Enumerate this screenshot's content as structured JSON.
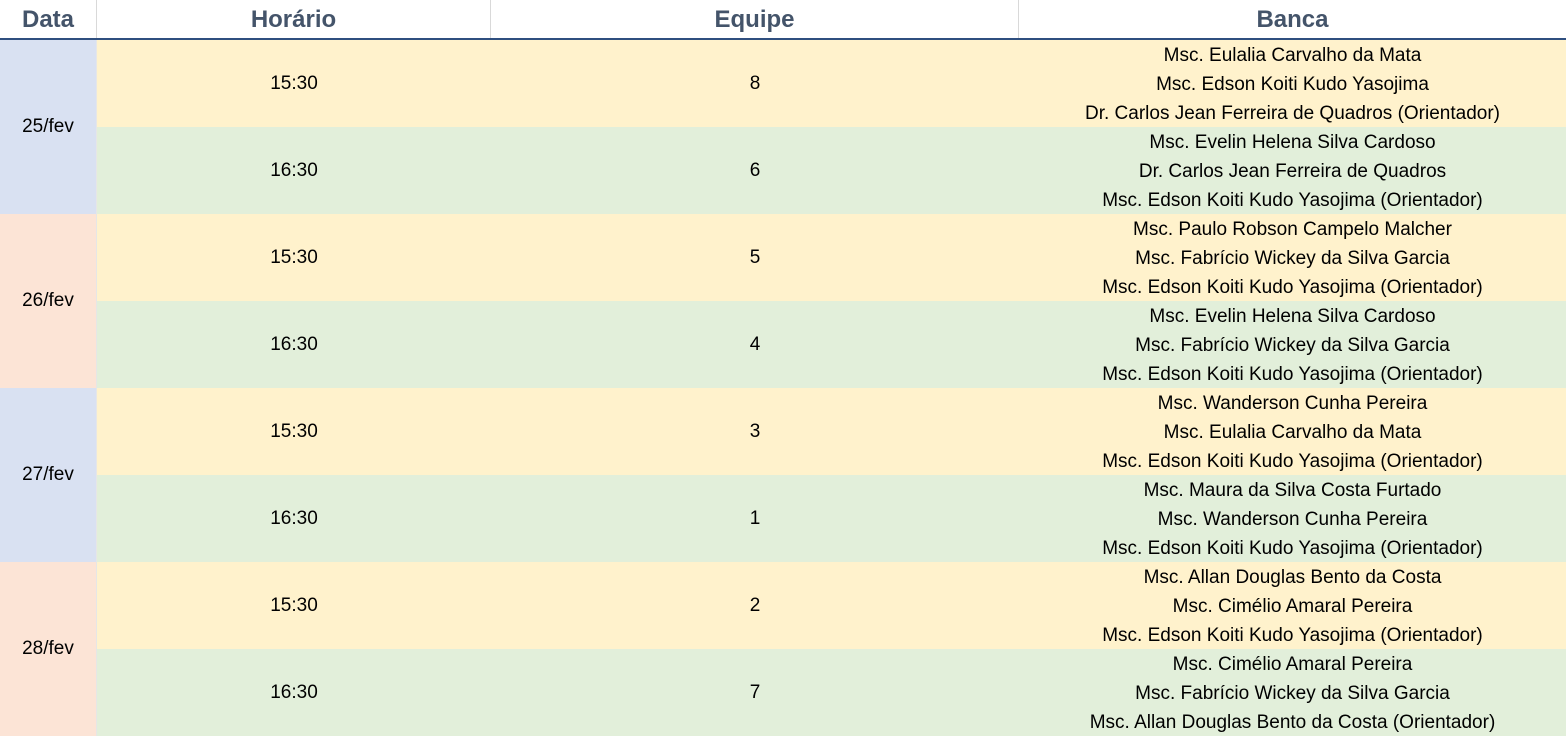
{
  "headers": {
    "data": "Data",
    "horario": "Horário",
    "equipe": "Equipe",
    "banca": "Banca"
  },
  "colors": {
    "header_text": "#44546a",
    "header_rule": "#2f4f7f",
    "date_blue": "#d9e1f2",
    "date_peach": "#fce4d6",
    "row_yellow": "#fff2cc",
    "row_green": "#e2efda"
  },
  "days": [
    {
      "date": "25/fev",
      "color": "#d9e1f2",
      "slots": [
        {
          "time": "15:30",
          "team": "8",
          "color": "#fff2cc",
          "banca": [
            "Msc. Eulalia Carvalho da Mata",
            "Msc. Edson Koiti Kudo Yasojima",
            "Dr. Carlos Jean Ferreira de Quadros (Orientador)"
          ]
        },
        {
          "time": "16:30",
          "team": "6",
          "color": "#e2efda",
          "banca": [
            "Msc. Evelin Helena Silva Cardoso",
            "Dr. Carlos Jean Ferreira de Quadros",
            "Msc. Edson Koiti Kudo Yasojima (Orientador)"
          ]
        }
      ]
    },
    {
      "date": "26/fev",
      "color": "#fce4d6",
      "slots": [
        {
          "time": "15:30",
          "team": "5",
          "color": "#fff2cc",
          "banca": [
            "Msc. Paulo Robson Campelo Malcher",
            "Msc. Fabrício Wickey da Silva Garcia",
            "Msc. Edson Koiti Kudo Yasojima (Orientador)"
          ]
        },
        {
          "time": "16:30",
          "team": "4",
          "color": "#e2efda",
          "banca": [
            "Msc. Evelin Helena Silva Cardoso",
            "Msc. Fabrício Wickey da Silva Garcia",
            "Msc. Edson Koiti Kudo Yasojima (Orientador)"
          ]
        }
      ]
    },
    {
      "date": "27/fev",
      "color": "#d9e1f2",
      "slots": [
        {
          "time": "15:30",
          "team": "3",
          "color": "#fff2cc",
          "banca": [
            "Msc. Wanderson Cunha Pereira",
            "Msc. Eulalia Carvalho da Mata",
            "Msc. Edson Koiti Kudo Yasojima (Orientador)"
          ]
        },
        {
          "time": "16:30",
          "team": "1",
          "color": "#e2efda",
          "banca": [
            "Msc. Maura da Silva Costa Furtado",
            "Msc. Wanderson Cunha Pereira",
            "Msc. Edson Koiti Kudo Yasojima (Orientador)"
          ]
        }
      ]
    },
    {
      "date": "28/fev",
      "color": "#fce4d6",
      "slots": [
        {
          "time": "15:30",
          "team": "2",
          "color": "#fff2cc",
          "banca": [
            "Msc. Allan Douglas Bento da Costa",
            "Msc. Cimélio Amaral Pereira",
            "Msc. Edson Koiti Kudo Yasojima (Orientador)"
          ]
        },
        {
          "time": "16:30",
          "team": "7",
          "color": "#e2efda",
          "banca": [
            "Msc. Cimélio Amaral Pereira",
            "Msc. Fabrício Wickey da Silva Garcia",
            "Msc. Allan Douglas Bento da Costa (Orientador)"
          ]
        }
      ]
    }
  ]
}
